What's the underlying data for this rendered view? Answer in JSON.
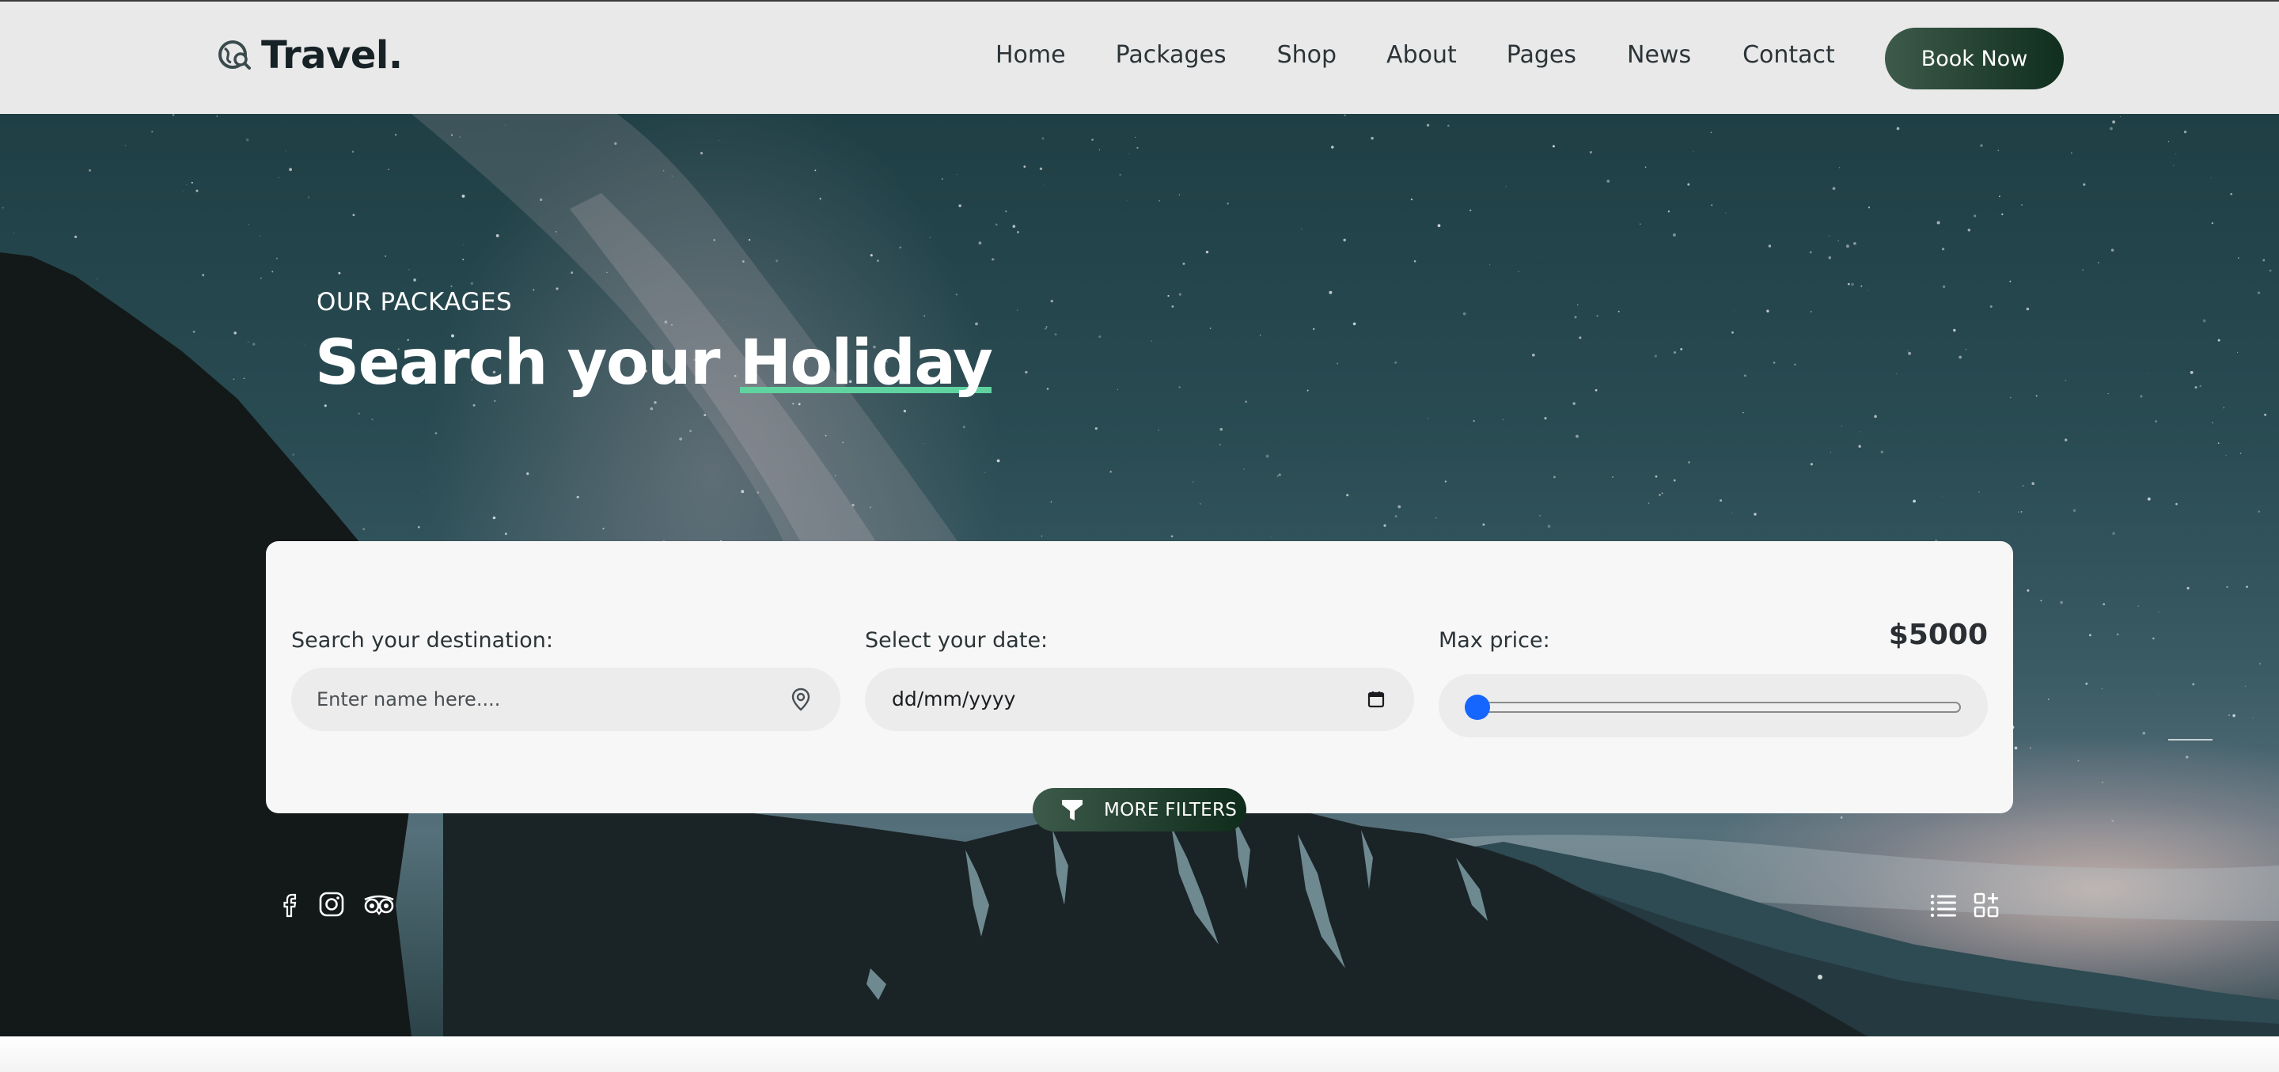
{
  "brand": {
    "name": "Travel.",
    "logo_icon": "globe-search-icon"
  },
  "nav": {
    "items": [
      {
        "label": "Home"
      },
      {
        "label": "Packages"
      },
      {
        "label": "Shop"
      },
      {
        "label": "About"
      },
      {
        "label": "Pages"
      },
      {
        "label": "News"
      },
      {
        "label": "Contact"
      }
    ],
    "cta_label": "Book Now",
    "cta_color": "#1f3d2d"
  },
  "hero": {
    "eyebrow": "OUR PACKAGES",
    "title_part1": "Search your ",
    "title_accent": "Holiday",
    "accent_color": "#5fd3a0"
  },
  "search": {
    "destination": {
      "label": "Search your destination:",
      "placeholder": "Enter name here....",
      "value": "",
      "icon": "map-pin-icon"
    },
    "date": {
      "label": "Select your date:",
      "value": "dd/mm/yyyy",
      "icon": "calendar-icon"
    },
    "price": {
      "label": "Max price:",
      "value_text": "$5000",
      "slider_fraction": 0.0,
      "thumb_color": "#1565ff"
    }
  },
  "filters": {
    "label": "MORE FILTERS",
    "icon": "funnel-icon"
  },
  "social": [
    {
      "name": "facebook-icon"
    },
    {
      "name": "instagram-icon"
    },
    {
      "name": "tripadvisor-icon"
    }
  ],
  "view_toggles": [
    {
      "name": "list-view-icon"
    },
    {
      "name": "grid-view-icon"
    }
  ]
}
